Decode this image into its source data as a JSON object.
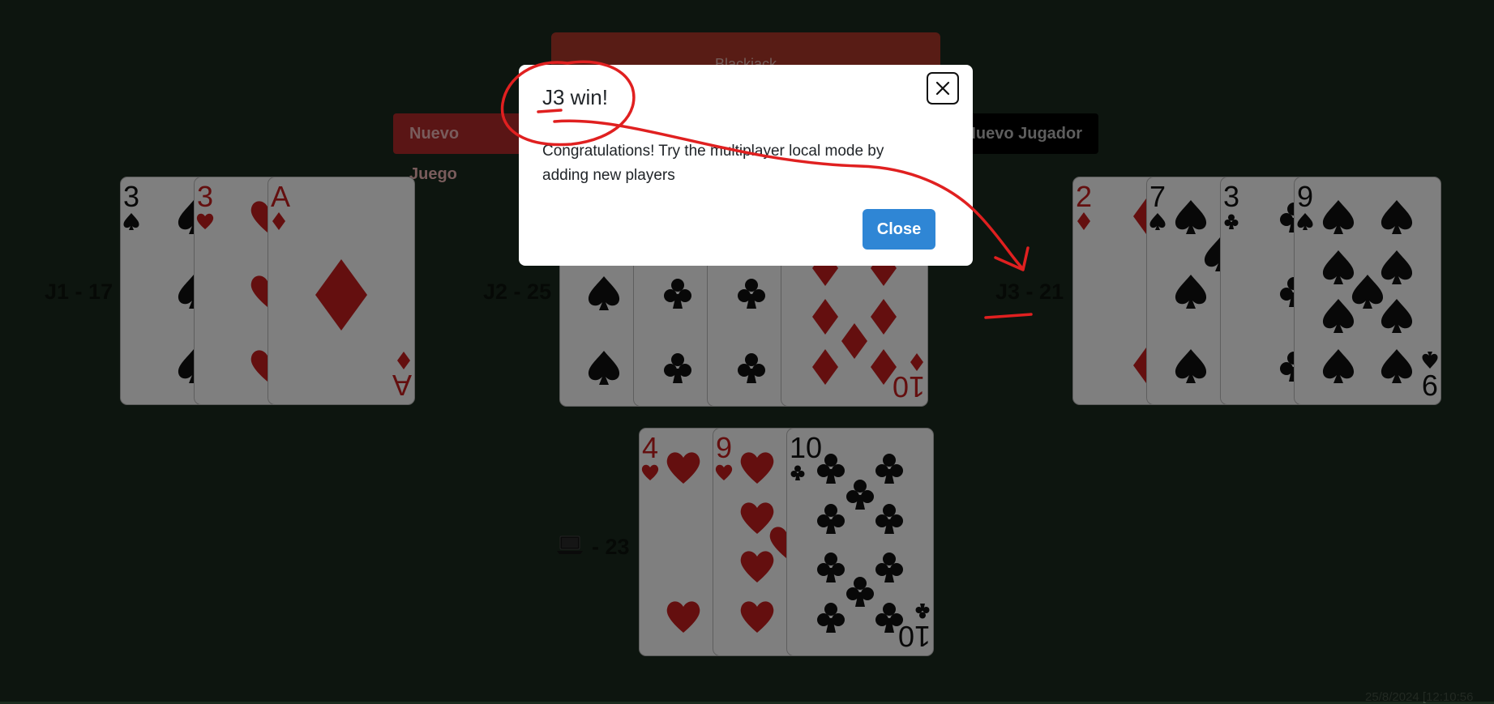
{
  "header": {
    "title": "Blackjack",
    "new_game_label": "Nuevo Juego",
    "new_player_label": "Nuevo Jugador"
  },
  "players": [
    {
      "label": "J1",
      "score": "17",
      "cards": [
        {
          "rank": "3",
          "suit": "spades"
        },
        {
          "rank": "3",
          "suit": "hearts"
        },
        {
          "rank": "A",
          "suit": "diamonds"
        }
      ]
    },
    {
      "label": "J2",
      "score": "25",
      "cards": [
        {
          "rank": "",
          "suit": "spades"
        },
        {
          "rank": "",
          "suit": "clubs"
        },
        {
          "rank": "",
          "suit": "clubs"
        },
        {
          "rank": "10",
          "suit": "diamonds"
        }
      ]
    },
    {
      "label": "J3",
      "score": "21",
      "cards": [
        {
          "rank": "2",
          "suit": "diamonds"
        },
        {
          "rank": "7",
          "suit": "spades"
        },
        {
          "rank": "3",
          "suit": "clubs"
        },
        {
          "rank": "9",
          "suit": "spades"
        }
      ]
    }
  ],
  "computer": {
    "icon": "laptop-icon",
    "score": "23",
    "cards": [
      {
        "rank": "4",
        "suit": "hearts"
      },
      {
        "rank": "9",
        "suit": "hearts"
      },
      {
        "rank": "10",
        "suit": "clubs"
      }
    ]
  },
  "modal": {
    "title": "J3 win!",
    "body": "Congratulations! Try the multiplayer local mode by adding new players",
    "close_label": "Close"
  },
  "timestamp": "25/8/2024 [12:10:56",
  "colors": {
    "background": "#1b2b1e",
    "red_suit": "#c81e1e",
    "black_suit": "#111111",
    "annotation": "#e02020",
    "button_primary": "#2f86d5"
  }
}
